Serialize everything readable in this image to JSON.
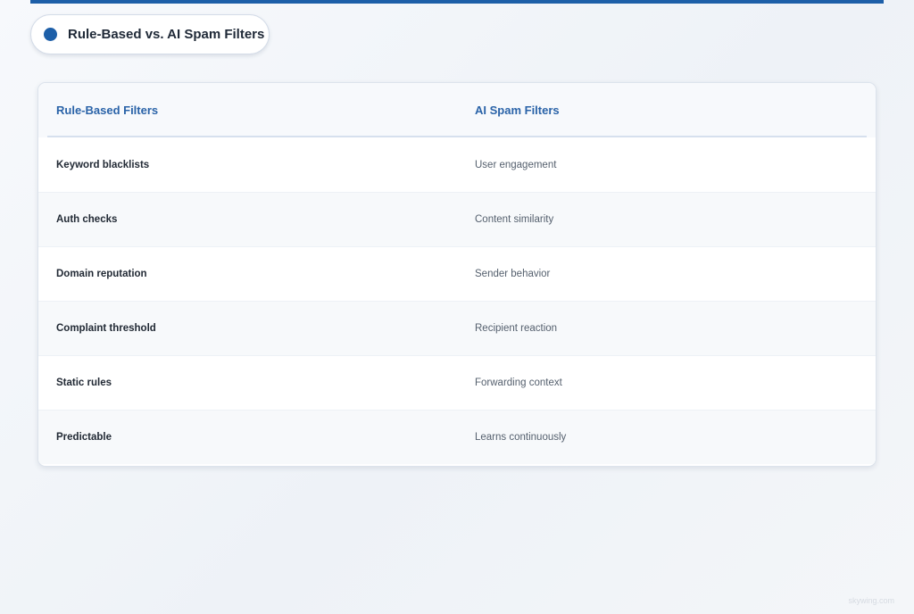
{
  "title": "Rule-Based vs. AI Spam Filters",
  "colors": {
    "accent": "#1d5fa8",
    "header_text": "#2a63a8"
  },
  "table": {
    "headers": [
      "Rule-Based Filters",
      "AI Spam Filters"
    ],
    "rows": [
      [
        "Keyword blacklists",
        "User engagement"
      ],
      [
        "Auth checks",
        "Content similarity"
      ],
      [
        "Domain reputation",
        "Sender behavior"
      ],
      [
        "Complaint threshold",
        "Recipient reaction"
      ],
      [
        "Static rules",
        "Forwarding context"
      ],
      [
        "Predictable",
        "Learns continuously"
      ]
    ]
  },
  "watermark": "skywing.com"
}
